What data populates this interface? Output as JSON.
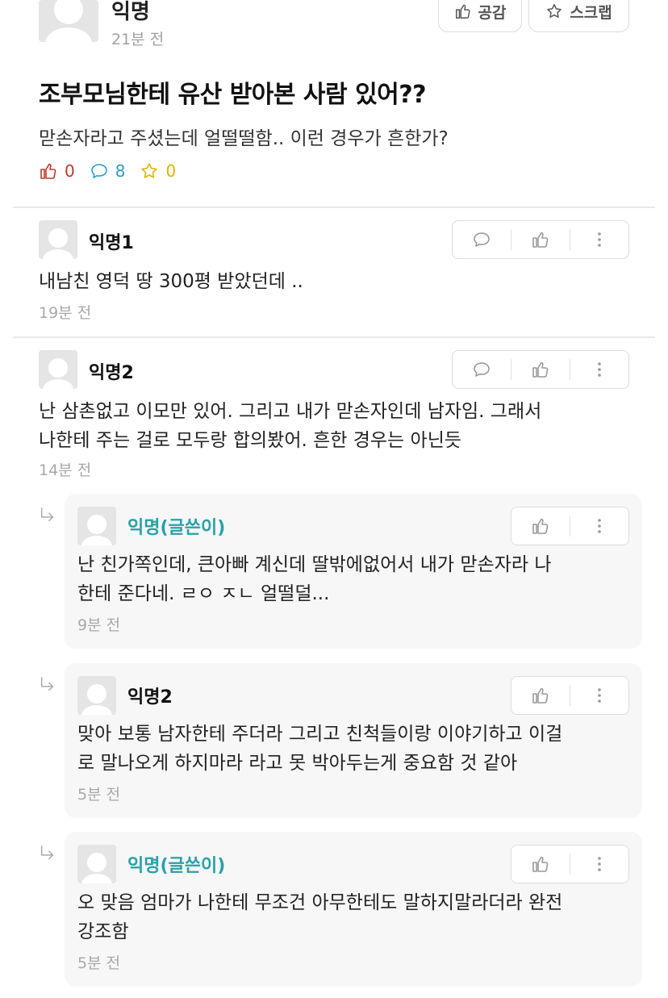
{
  "post": {
    "author": "익명",
    "time": "21분 전",
    "like_button_label": "공감",
    "scrap_button_label": "스크랩",
    "title": "조부모님한테 유산 받아본 사람 있어??",
    "body": "맏손자라고 주셨는데 얼떨떨함.. 이런 경우가 흔한가?",
    "like_count": "0",
    "comment_count": "8",
    "scrap_count": "0"
  },
  "comments": [
    {
      "author": "익명1",
      "text": "내남친 영덕 땅 300평 받았던데 ..",
      "time": "19분 전"
    },
    {
      "author": "익명2",
      "text_line1": "난 삼촌없고 이모만 있어. 그리고 내가 맏손자인데 남자임. 그래서",
      "text_line2": "나한테 주는 걸로 모두랑 합의봤어. 흔한 경우는 아닌듯",
      "time": "14분 전"
    }
  ],
  "replies": [
    {
      "author": "익명(글쓴이)",
      "text_line1": "난 친가쪽인데, 큰아빠 계신데 딸밖에없어서 내가 맏손자라 나",
      "text_line2": "한테 준다네. ㄹㅇ ㅈㄴ 얼떨덜...",
      "time": "9분 전"
    },
    {
      "author": "익명2",
      "text_line1": "맞아 보통 남자한테 주더라 그리고 친척들이랑 이야기하고 이걸",
      "text_line2": "로 말나오게 하지마라 라고 못 박아두는게 중요함 것 같아",
      "time": "5분 전"
    },
    {
      "author": "익명(글쓴이)",
      "text_line1": "오 맞음 엄마가 나한테 무조건 아무한테도 말하지말라더라 완전",
      "text_line2": "강조함",
      "time": "5분 전"
    }
  ],
  "colors": {
    "like_red": "#c0392b",
    "comment_blue": "#2aa1c4",
    "scrap_yellow": "#e2b400",
    "op_teal": "#2aa1a8"
  },
  "icons": {
    "like": "thumbs-up-icon",
    "comment": "speech-bubble-icon",
    "scrap": "star-icon",
    "more": "more-vertical-icon",
    "reply": "reply-arrow-icon"
  }
}
